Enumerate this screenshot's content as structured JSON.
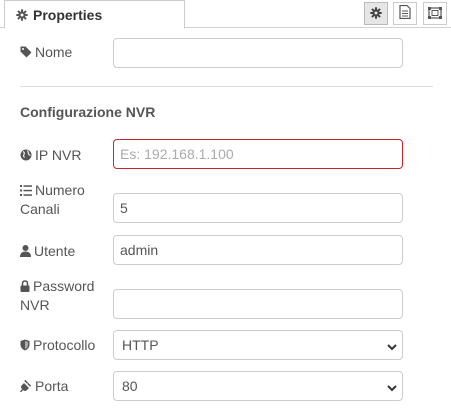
{
  "tab": {
    "label": "Properties",
    "icon": "gear-icon"
  },
  "toolbar": {
    "buttons": [
      "gear-icon",
      "description-icon",
      "appearance-icon"
    ]
  },
  "fields": {
    "nome": {
      "label": "Nome",
      "icon": "tag-icon",
      "value": "",
      "placeholder": ""
    },
    "ip": {
      "label": "IP NVR",
      "icon": "globe-icon",
      "value": "",
      "placeholder": "Es: 192.168.1.100"
    },
    "canali": {
      "label_line1": "Numero",
      "label_line2": "Canali",
      "icon": "list-icon",
      "value": "5"
    },
    "utente": {
      "label": "Utente",
      "icon": "user-icon",
      "value": "admin"
    },
    "password": {
      "label_line1": "Password",
      "label_line2": "NVR",
      "icon": "lock-icon",
      "value": ""
    },
    "protocollo": {
      "label": "Protocollo",
      "icon": "shield-icon",
      "selected": "HTTP"
    },
    "porta": {
      "label": "Porta",
      "icon": "plug-icon",
      "selected": "80"
    }
  },
  "section": {
    "title": "Configurazione NVR"
  },
  "colors": {
    "invalid_border": "#c0272d",
    "text": "#555555"
  }
}
